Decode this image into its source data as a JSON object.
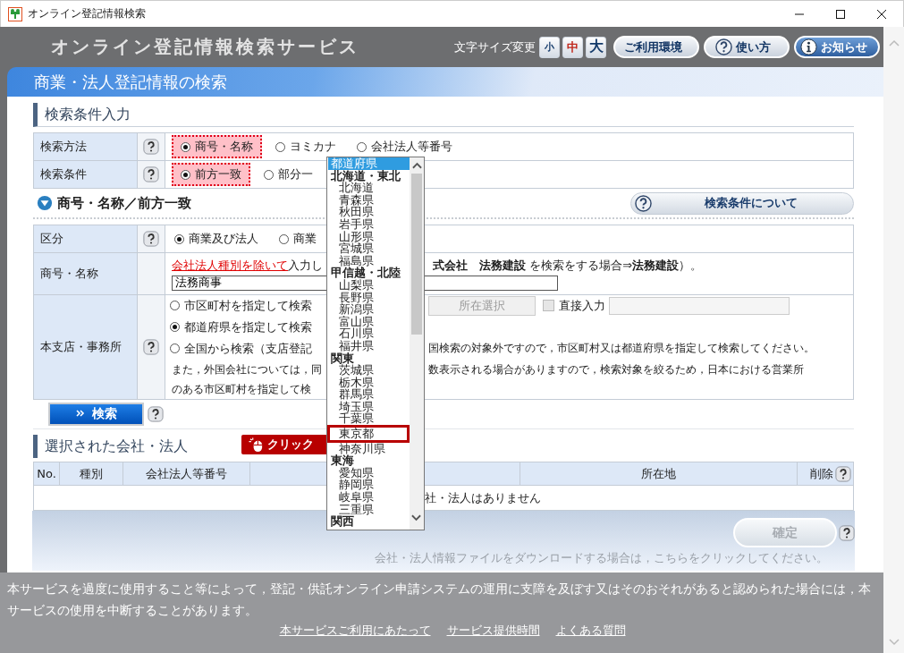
{
  "window": {
    "title": "オンライン登記情報検索"
  },
  "header": {
    "title": "オンライン登記情報検索サービス",
    "font_size_label": "文字サイズ変更",
    "font_sizes": [
      {
        "label": "小",
        "selected": false
      },
      {
        "label": "中",
        "selected": true
      },
      {
        "label": "大",
        "selected": false
      }
    ],
    "nav_buttons": [
      {
        "label": "ご利用環境",
        "kind": "plain"
      },
      {
        "label": "使い方",
        "kind": "help"
      },
      {
        "label": "お知らせ",
        "kind": "info"
      }
    ]
  },
  "banner": "商業・法人登記情報の検索",
  "conditions": {
    "heading": "検索条件入力",
    "rows": [
      {
        "label": "検索方法",
        "options": [
          {
            "label": "商号・名称",
            "selected": true
          },
          {
            "label": "ヨミカナ",
            "selected": false
          },
          {
            "label": "会社法人等番号",
            "selected": false
          }
        ]
      },
      {
        "label": "検索条件",
        "options": [
          {
            "label": "前方一致",
            "selected": true
          },
          {
            "label": "部分一",
            "selected": false
          }
        ]
      }
    ]
  },
  "subsection": {
    "title": "商号・名称／前方一致",
    "button": "検索条件について"
  },
  "form": {
    "category": {
      "label": "区分",
      "options": [
        {
          "label": "商業及び法人",
          "selected": true
        },
        {
          "label": "商業",
          "selected": false
        }
      ]
    },
    "name": {
      "label": "商号・名称",
      "hint_link": "会社法人種別を除いて",
      "hint_left": "入力し",
      "hint_right": "**式会社　法務建設** を検索をする場合⇒**法務建設**）。",
      "value": "法務商事"
    },
    "office": {
      "label": "本支店・事務所",
      "options": [
        {
          "label": "市区町村を指定して検索",
          "selected": false
        },
        {
          "label": "都道府県を指定して検索",
          "selected": true
        },
        {
          "label": "全国から検索（支店登記",
          "selected": false
        }
      ],
      "location_button": {
        "label": "所在選択",
        "disabled": true
      },
      "direct_input": {
        "label": "直接入力",
        "checked": false,
        "disabled": true
      },
      "note_right": "国検索の対象外ですので，市区町村又は都道府県を指定して検索してください。",
      "note_lines": [
        {
          "left": "また，外国会社については，同",
          "right": "数表示される場合がありますので，検索対象を絞るため，日本における営業所"
        },
        {
          "left": "のある市区町村を指定して検"
        }
      ]
    }
  },
  "search_button": "検索",
  "selected_section": {
    "heading": "選択された会社・法人",
    "columns": [
      {
        "label": "No."
      },
      {
        "label": "種別"
      },
      {
        "label": "会社法人等番号"
      },
      {
        "label": "所在地"
      },
      {
        "label": "削除",
        "help": true
      }
    ],
    "empty_message": "社・法人はありません",
    "confirm_button": {
      "label": "確定",
      "disabled": true
    },
    "download_note": "会社・法人情報ファイルをダウンロードする場合は，こちらをクリックしてください。"
  },
  "footer": {
    "notice": "本サービスを過度に使用すること等によって，登記・供託オンライン申請システムの運用に支障を及ぼす又はそのおそれがあると認められた場合には，本サービスの使用を中断することがあります。",
    "links": [
      "本サービスご利用にあたって",
      "サービス提供時間",
      "よくある質問"
    ]
  },
  "dropdown": {
    "items": [
      {
        "kind": "option",
        "label": "都道府県",
        "selected": true
      },
      {
        "kind": "group",
        "label": "北海道・東北",
        "children": [
          {
            "label": "北海道",
            "selected": false,
            "marked": false
          },
          {
            "label": "青森県",
            "selected": false,
            "marked": false
          },
          {
            "label": "秋田県",
            "selected": false,
            "marked": false
          },
          {
            "label": "岩手県",
            "selected": false,
            "marked": false
          },
          {
            "label": "山形県",
            "selected": false,
            "marked": false
          },
          {
            "label": "宮城県",
            "selected": false,
            "marked": false
          },
          {
            "label": "福島県",
            "selected": false,
            "marked": false
          }
        ]
      },
      {
        "kind": "group",
        "label": "甲信越・北陸",
        "children": [
          {
            "label": "山梨県",
            "selected": false,
            "marked": false
          },
          {
            "label": "長野県",
            "selected": false,
            "marked": false
          },
          {
            "label": "新潟県",
            "selected": false,
            "marked": false
          },
          {
            "label": "富山県",
            "selected": false,
            "marked": false
          },
          {
            "label": "石川県",
            "selected": false,
            "marked": false
          },
          {
            "label": "福井県",
            "selected": false,
            "marked": false
          }
        ]
      },
      {
        "kind": "group",
        "label": "関東",
        "children": [
          {
            "label": "茨城県",
            "selected": false,
            "marked": false
          },
          {
            "label": "栃木県",
            "selected": false,
            "marked": false
          },
          {
            "label": "群馬県",
            "selected": false,
            "marked": false
          },
          {
            "label": "埼玉県",
            "selected": false,
            "marked": false
          },
          {
            "label": "千葉県",
            "selected": false,
            "marked": false
          },
          {
            "label": "東京都",
            "selected": false,
            "marked": true
          },
          {
            "label": "神奈川県",
            "selected": false,
            "marked": false
          }
        ]
      },
      {
        "kind": "group",
        "label": "東海",
        "children": [
          {
            "label": "愛知県",
            "selected": false,
            "marked": false
          },
          {
            "label": "静岡県",
            "selected": false,
            "marked": false
          },
          {
            "label": "岐阜県",
            "selected": false,
            "marked": false
          },
          {
            "label": "三重県",
            "selected": false,
            "marked": false
          }
        ]
      },
      {
        "kind": "group",
        "label": "関西"
      }
    ]
  },
  "callout": {
    "label": "クリック"
  }
}
